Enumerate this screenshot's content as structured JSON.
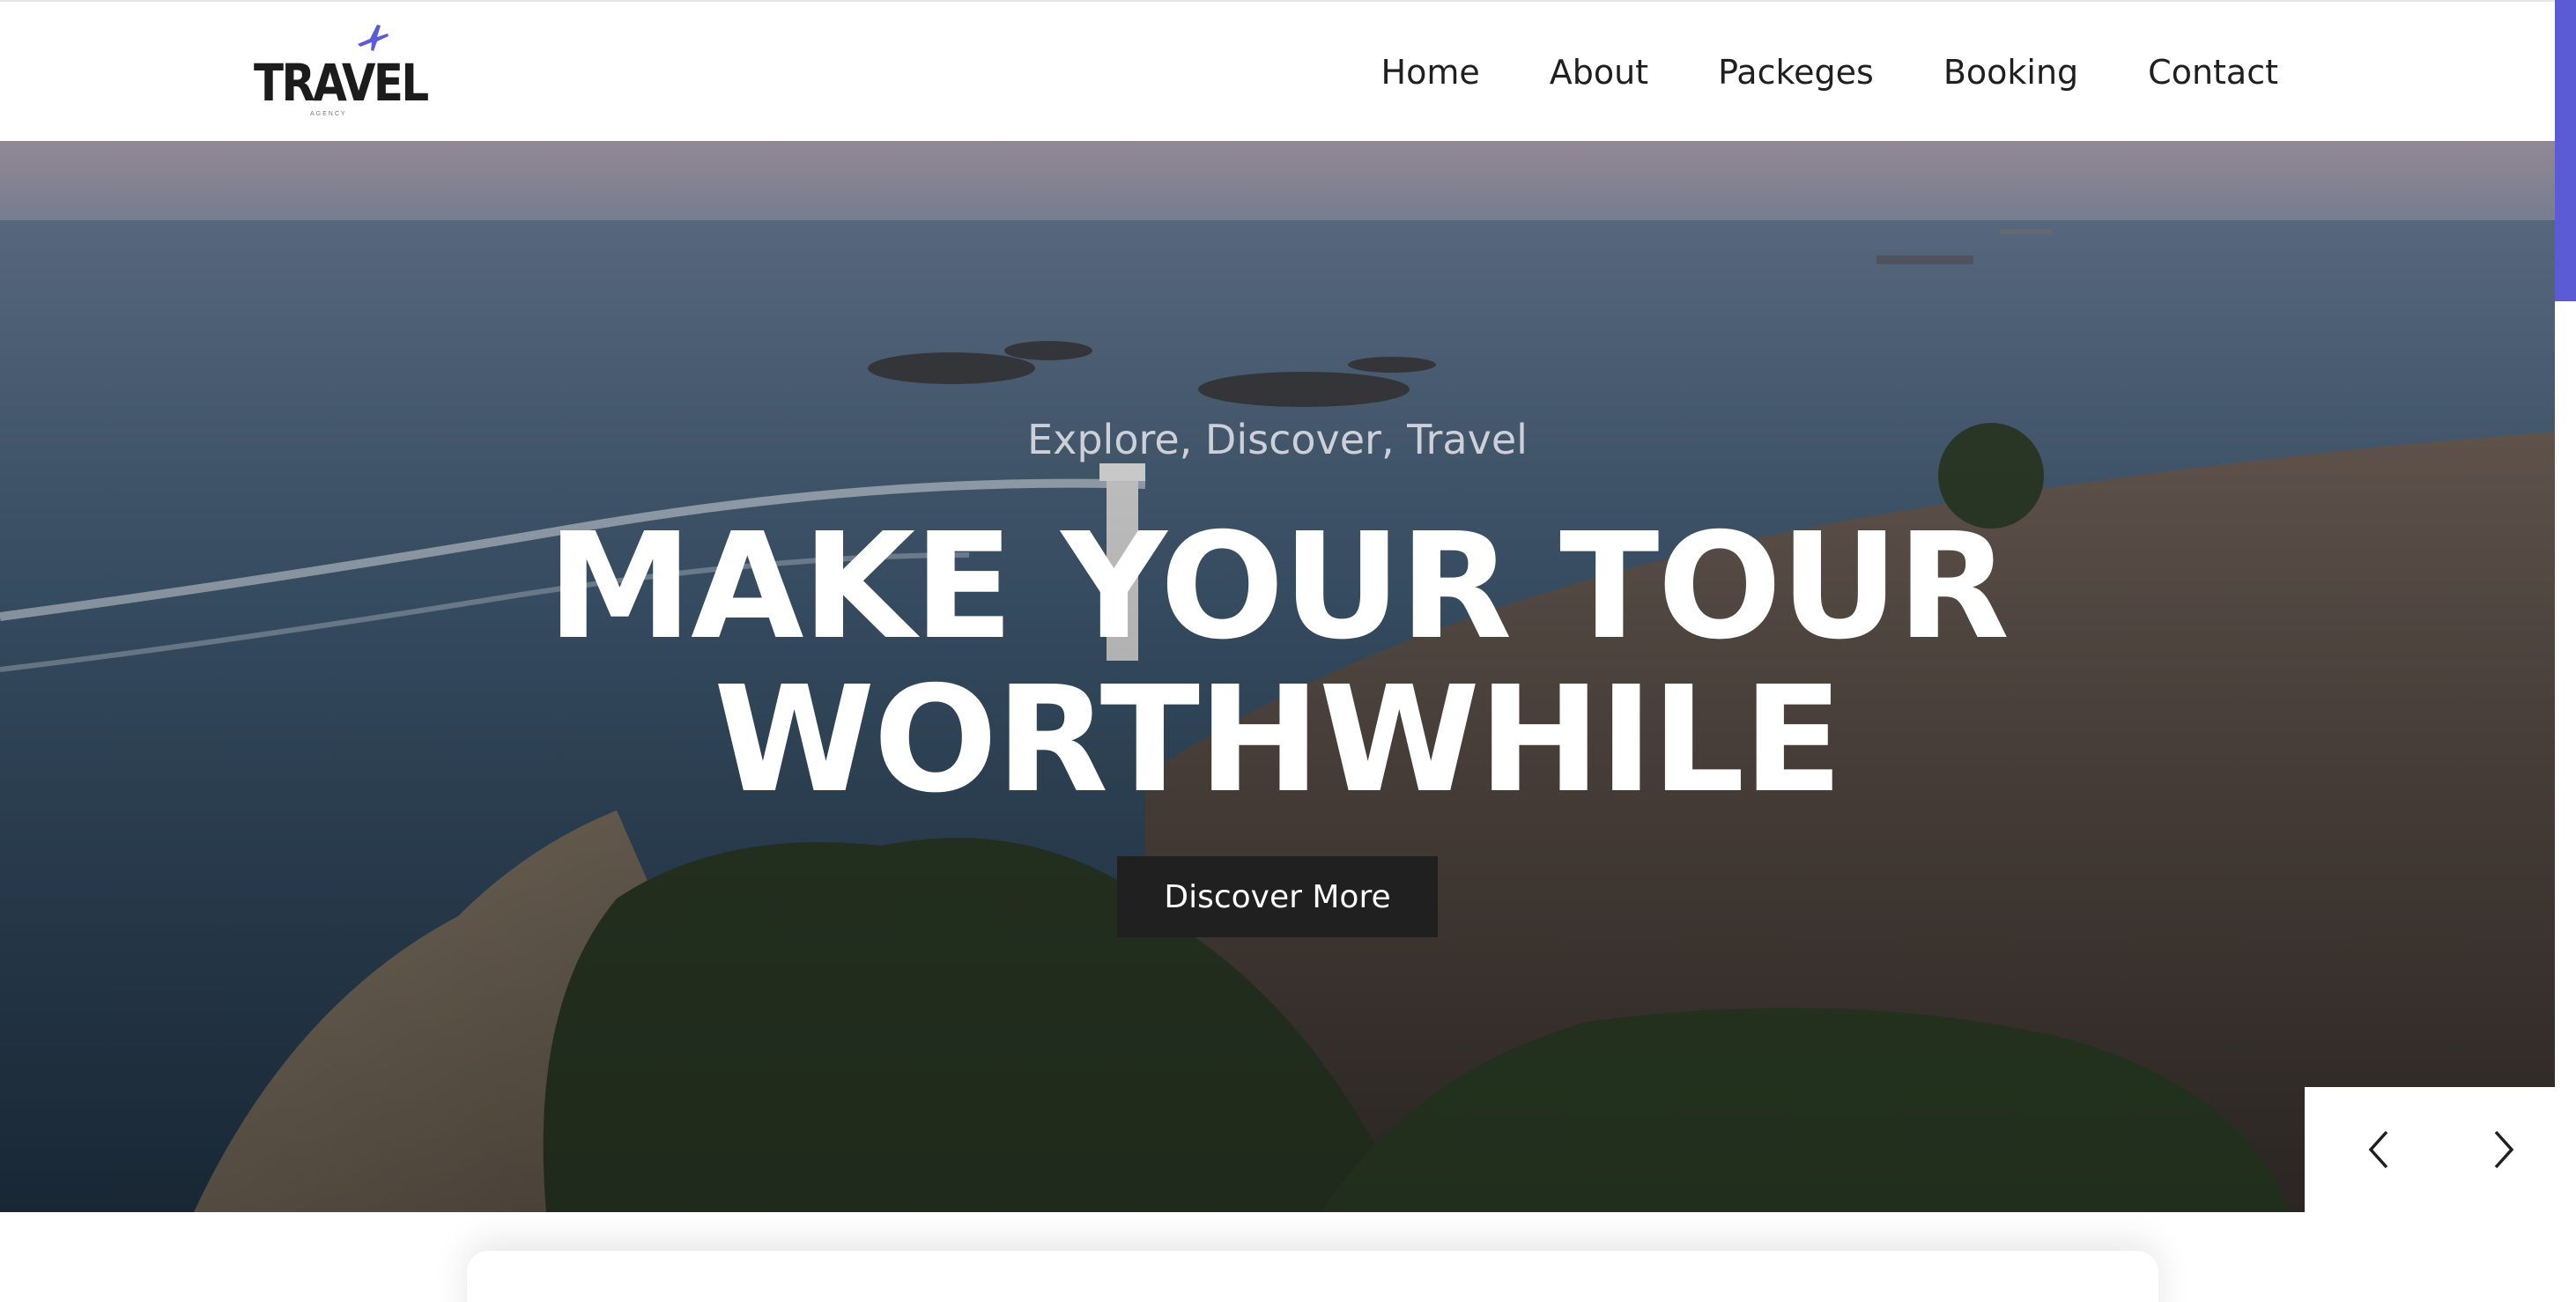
{
  "header": {
    "logo_text": "TRAVEL",
    "logo_subtext": "AGENCY",
    "nav": [
      {
        "label": "Home"
      },
      {
        "label": "About"
      },
      {
        "label": "Packeges"
      },
      {
        "label": "Booking"
      },
      {
        "label": "Contact"
      }
    ]
  },
  "hero": {
    "tagline": "Explore, Discover, Travel",
    "headline_line1": "MAKE YOUR TOUR",
    "headline_line2": "WORTHWHILE",
    "cta_label": "Discover More"
  },
  "slider": {
    "prev_icon": "chevron-left-icon",
    "next_icon": "chevron-right-icon"
  },
  "colors": {
    "accent": "#5b5bd6",
    "button_bg": "#202020",
    "text_dark": "#1f1f1f"
  }
}
